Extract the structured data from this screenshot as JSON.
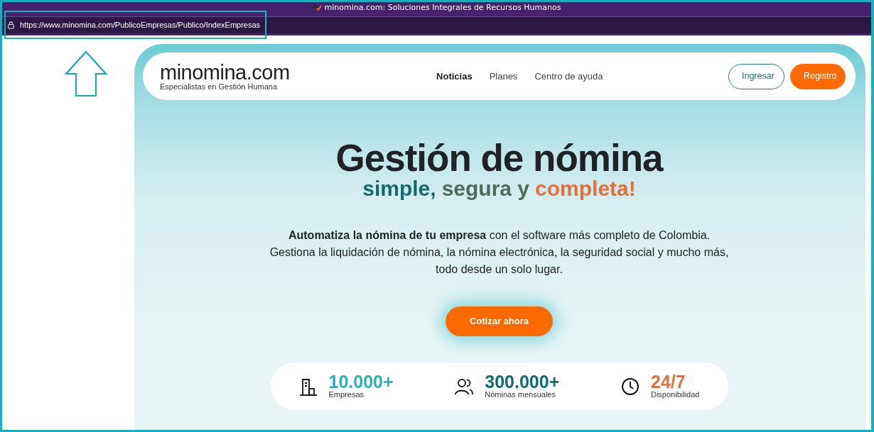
{
  "browser": {
    "tab_title": "minomina.com: Soluciones Integrales de Recursos Humanos",
    "url": "https://www.minomina.com/PublicoEmpresas/Publico/IndexEmpresas"
  },
  "header": {
    "logo": "minomina.com",
    "tagline": "Especialistas en Gestión Humana",
    "nav": [
      {
        "label": "Noticias",
        "selected": true
      },
      {
        "label": "Planes",
        "selected": false
      },
      {
        "label": "Centro de ayuda",
        "selected": false
      }
    ],
    "buttons": [
      {
        "label": "Ingresar",
        "kind": "outline"
      },
      {
        "label": "Registro",
        "kind": "solid"
      }
    ]
  },
  "hero": {
    "title": "Gestión de nómina",
    "subtitle": [
      {
        "text": "simple,",
        "color": "#17696b"
      },
      {
        "text": "segura y",
        "color": "#4f6b5a"
      },
      {
        "text": "completa!",
        "color": "#e0703e"
      }
    ],
    "description": "**Automatiza la nómina de tu empresa** con el software más completo de Colombia. Gestiona la liquidación de nómina, la nómina electrónica, la seguridad social y mucho más, todo desde un solo lugar.",
    "cta": "Cotizar ahora"
  },
  "stats": [
    {
      "kind": "building",
      "value": "10.000+",
      "label": "Empresas",
      "color": "#2ab0b8"
    },
    {
      "kind": "people",
      "value": "300.000+",
      "label": "Nóminas mensuales",
      "color": "#106b6b"
    },
    {
      "kind": "clock",
      "value": "24/7",
      "label": "Disponibilidad",
      "color": "#e0703e"
    }
  ]
}
